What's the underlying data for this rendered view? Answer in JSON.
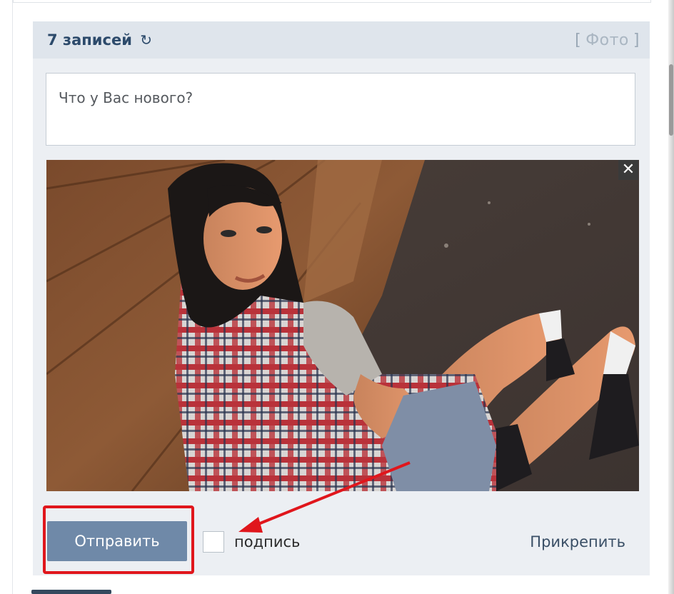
{
  "wall": {
    "posts_count_label": "7 записей",
    "refresh_glyph": "↻",
    "photo_link": {
      "bracket_open": "[",
      "label": "Фото",
      "bracket_close": "]"
    }
  },
  "composer": {
    "placeholder": "Что у Вас нового?",
    "remove_attachment_glyph": "✕",
    "send_label": "Отправить",
    "sign_label": "подпись",
    "sign_checked": false,
    "attach_label": "Прикрепить"
  },
  "icons": [
    "refresh-icon",
    "close-icon"
  ],
  "colors": {
    "header_bg": "#dfe5ec",
    "title_text": "#2c4a6b",
    "send_button": "#6f89a8",
    "highlight": "#e0161c"
  }
}
